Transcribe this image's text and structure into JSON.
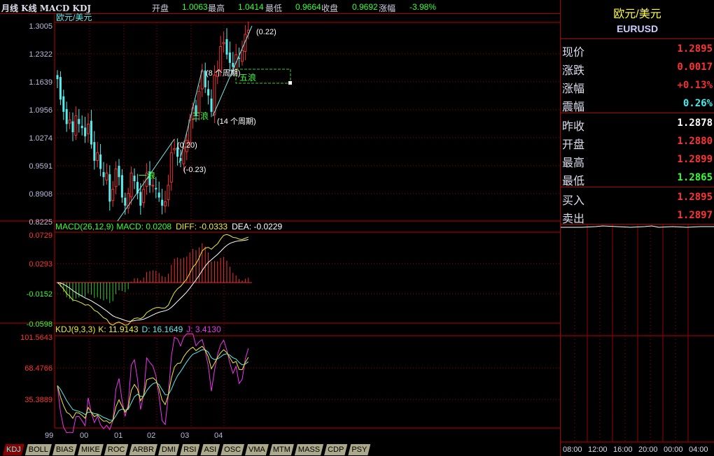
{
  "header": {
    "title": "月线 K线 MACD KDJ",
    "open_label": "开盘",
    "open": "1.0063",
    "high_label": "最高",
    "high": "1.0414",
    "low_label": "最低",
    "low": "0.9664",
    "close_label": "收盘",
    "close": "0.9692",
    "chg_label": "涨幅",
    "chg": "-3.98%"
  },
  "main_panel": {
    "name": "欧元/美元",
    "price_ticks": [
      "1.3005",
      "1.2322",
      "1.1639",
      "1.0956",
      "1.0274",
      "0.9591",
      "0.8908",
      "0.8225"
    ],
    "annotations": {
      "wave1": "一浪",
      "wave3": "三浪",
      "wave5": "五浪",
      "a1": "(0.20)",
      "a2": "(-0.23)",
      "a3": "(8 个周期)",
      "a4": "(14 个周期)",
      "a5": "(0.22)"
    }
  },
  "macd_panel": {
    "title": "MACD(26,12,9)",
    "macd": "MACD: 0.0208",
    "diff": "DIFF: -0.0333",
    "dea": "DEA: -0.0229",
    "ticks": [
      "0.0729",
      "0.0293",
      "-0.0152",
      "-0.0598"
    ]
  },
  "kdj_panel": {
    "title": "KDJ(9,3,3)",
    "k": "K: 11.9143",
    "d": "D: 16.1649",
    "j": "J: 3.4130",
    "ticks": [
      "101.5643",
      "68.4766",
      "35.3889"
    ]
  },
  "x_labels": [
    "99",
    "00",
    "01",
    "02",
    "03",
    "04"
  ],
  "tabs": [
    "KDJ",
    "BOLL",
    "BIAS",
    "MIKE",
    "ROC",
    "ARBR",
    "DMI",
    "RSI",
    "ASI",
    "OSC",
    "VMA",
    "MTM",
    "MASS",
    "CDP",
    "PSY"
  ],
  "quote": {
    "name": "欧元/美元",
    "symbol": "EURUSD",
    "rows": [
      {
        "k": "现价",
        "v": "1.2895",
        "c": "#f33"
      },
      {
        "k": "涨跌",
        "v": "0.0017",
        "c": "#f33"
      },
      {
        "k": "涨幅",
        "v": "+0.13%",
        "c": "#e33"
      },
      {
        "k": "震幅",
        "v": "0.26%",
        "c": "#4ee"
      },
      {
        "k": "昨收",
        "v": "1.2878",
        "c": "#fff"
      },
      {
        "k": "开盘",
        "v": "1.2880",
        "c": "#f33"
      },
      {
        "k": "最高",
        "v": "1.2899",
        "c": "#f33"
      },
      {
        "k": "最低",
        "v": "1.2865",
        "c": "#3f3"
      },
      {
        "k": "买入",
        "v": "1.2895",
        "c": "#f33"
      },
      {
        "k": "卖出",
        "v": "1.2897",
        "c": "#f33"
      }
    ]
  },
  "intraday_times": [
    "08:00",
    "12:00",
    "16:00",
    "20:00",
    "00:00",
    "04:00"
  ],
  "chart_data": {
    "type": "candlestick",
    "period": "monthly",
    "ylim": [
      0.8225,
      1.3005
    ],
    "closes": [
      1.17,
      1.12,
      1.09,
      1.06,
      1.07,
      1.04,
      1.08,
      1.06,
      1.05,
      1.03,
      1.06,
      1.01,
      0.97,
      0.99,
      0.95,
      0.93,
      0.94,
      0.87,
      0.9,
      0.95,
      0.93,
      0.88,
      0.86,
      0.89,
      0.94,
      0.92,
      0.89,
      0.86,
      0.9,
      0.94,
      0.91,
      0.91,
      0.9,
      0.88,
      0.86,
      0.87,
      0.91,
      0.99,
      1.0,
      0.98,
      0.97,
      1.0,
      1.02,
      1.07,
      1.1,
      1.08,
      1.14,
      1.19,
      1.15,
      1.13,
      1.09,
      1.18,
      1.19,
      1.25,
      1.26,
      1.23,
      1.21,
      1.2,
      1.23,
      1.22,
      1.24,
      1.28,
      1.29
    ]
  }
}
